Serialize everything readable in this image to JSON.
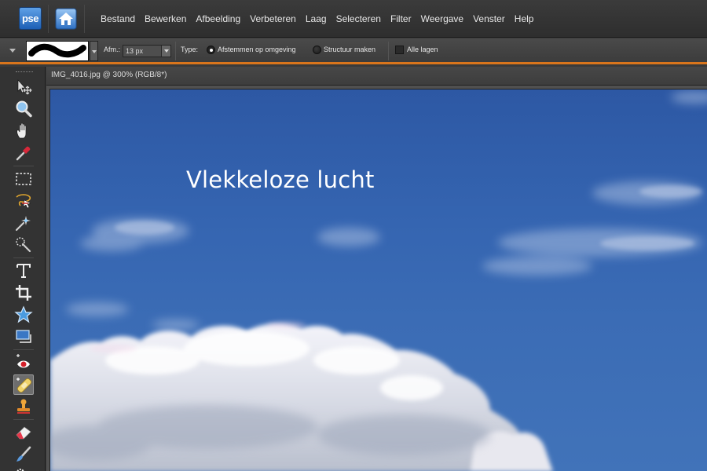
{
  "app": {
    "logo_text": "pse",
    "accent_color": "#d9751c"
  },
  "menu": {
    "items": [
      "Bestand",
      "Bewerken",
      "Afbeelding",
      "Verbeteren",
      "Laag",
      "Selecteren",
      "Filter",
      "Weergave",
      "Venster",
      "Help"
    ]
  },
  "options": {
    "size_label": "Afm.:",
    "size_value": "13 px",
    "type_label": "Type:",
    "radio_1_label": "Afstemmen op omgeving",
    "radio_1_selected": true,
    "radio_2_label": "Structuur maken",
    "radio_2_selected": false,
    "all_layers_label": "Alle lagen",
    "all_layers_checked": false
  },
  "tools": [
    "move-tool",
    "zoom-tool",
    "hand-tool",
    "eyedropper-tool",
    "marquee-tool",
    "lasso-tool",
    "magic-wand-tool",
    "quick-selection-tool",
    "type-tool",
    "crop-tool",
    "cookie-cutter-tool",
    "straighten-tool",
    "red-eye-tool",
    "spot-healing-brush-tool",
    "clone-stamp-tool",
    "eraser-tool",
    "brush-tool",
    "smart-brush-tool"
  ],
  "active_tool": "spot-healing-brush-tool",
  "document": {
    "title": "IMG_4016.jpg @ 300% (RGB/8*)",
    "caption": "Vlekkeloze lucht"
  }
}
